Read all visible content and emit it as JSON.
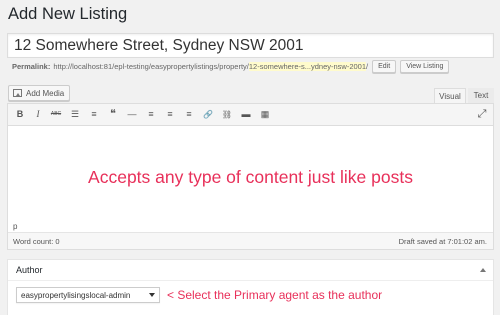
{
  "page": {
    "title": "Add New Listing"
  },
  "post_title": {
    "value": "12 Somewhere Street, Sydney NSW 2001"
  },
  "permalink": {
    "label": "Permalink:",
    "base": "http://localhost:81/epl-testing/easypropertylistings/property/",
    "slug": "12-somewhere-s...ydney-nsw-2001",
    "trail": "/",
    "edit_label": "Edit",
    "view_label": "View Listing"
  },
  "editor": {
    "add_media_label": "Add Media",
    "tabs": {
      "visual": "Visual",
      "text": "Text"
    },
    "toolbar_icons": [
      {
        "name": "bold-icon",
        "glyph": "B"
      },
      {
        "name": "italic-icon",
        "glyph": "I"
      },
      {
        "name": "strikethrough-icon",
        "glyph": "ABC"
      },
      {
        "name": "bullet-list-icon",
        "glyph": "☰"
      },
      {
        "name": "numbered-list-icon",
        "glyph": "≡"
      },
      {
        "name": "blockquote-icon",
        "glyph": "❝"
      },
      {
        "name": "horizontal-rule-icon",
        "glyph": "—"
      },
      {
        "name": "align-left-icon",
        "glyph": "≡"
      },
      {
        "name": "align-center-icon",
        "glyph": "≡"
      },
      {
        "name": "align-right-icon",
        "glyph": "≡"
      },
      {
        "name": "link-icon",
        "glyph": "🔗"
      },
      {
        "name": "unlink-icon",
        "glyph": "⛓"
      },
      {
        "name": "read-more-icon",
        "glyph": "▬"
      },
      {
        "name": "toolbar-toggle-icon",
        "glyph": "▦"
      }
    ],
    "fullscreen_icon": "⤢",
    "content": "Accepts any type of content just like posts",
    "path": "p",
    "word_count": "Word count: 0",
    "draft_status": "Draft saved at 7:01:02 am."
  },
  "author_box": {
    "title": "Author",
    "selected_author": "easypropertylisingslocal-admin",
    "annotation": "< Select the Primary agent as the author"
  }
}
